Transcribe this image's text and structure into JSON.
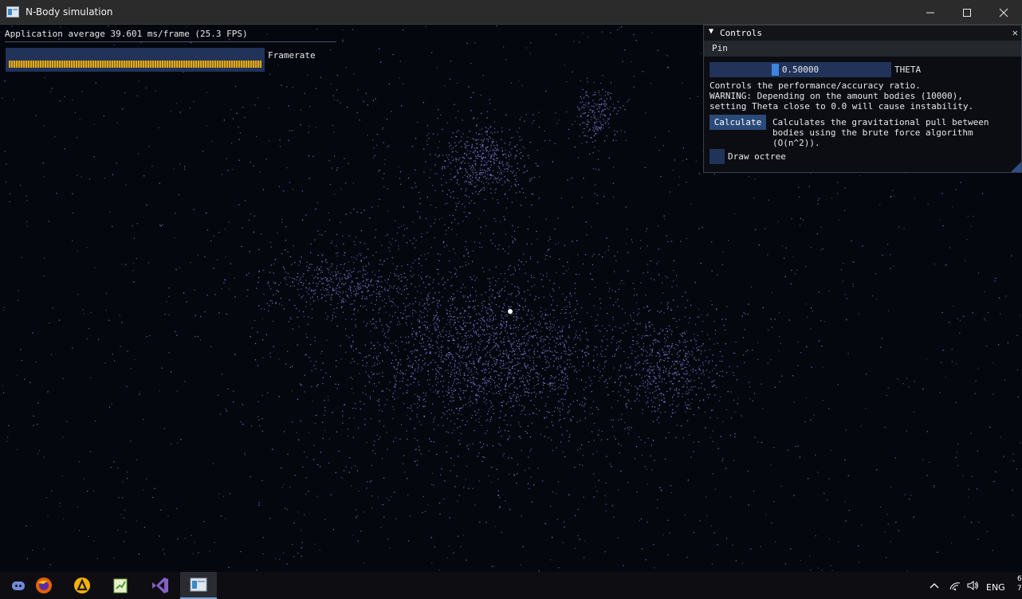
{
  "window": {
    "title": "N-Body simulation",
    "controls": [
      "minimize",
      "maximize",
      "close"
    ]
  },
  "overlay": {
    "fps_text": "Application average 39.601 ms/frame (25.3 FPS)",
    "plot_label": "Framerate"
  },
  "controls_panel": {
    "title": "Controls",
    "menu_pin": "Pin",
    "theta": {
      "value": "0.50000",
      "value_fraction": 0.5,
      "label": "THETA"
    },
    "theta_help": "Controls the performance/accuracy ratio.\nWARNING: Depending on the amount bodies (10000),\nsetting Theta close to 0.0 will cause instability.",
    "calculate_button": "Calculate",
    "calculate_help": "Calculates the gravitational pull between\nbodies using the brute force algorithm\n(O(n^2)).",
    "draw_octree_label": "Draw octree",
    "draw_octree_checked": false
  },
  "taskbar": {
    "apps": [
      "discord-icon",
      "firefox-icon",
      "app-launcher-icon",
      "notepad-plus-icon",
      "visual-studio-icon",
      "nbody-app-icon"
    ],
    "active_app": "nbody-app-icon",
    "tray_language": "ENG",
    "tray_clock": "6\n7"
  },
  "colors": {
    "background": "#05070f",
    "particle": "#8f86e6",
    "framerate_bars": "#e1a91e",
    "widget_bg": "#22335a",
    "accent": "#3d84e0"
  }
}
